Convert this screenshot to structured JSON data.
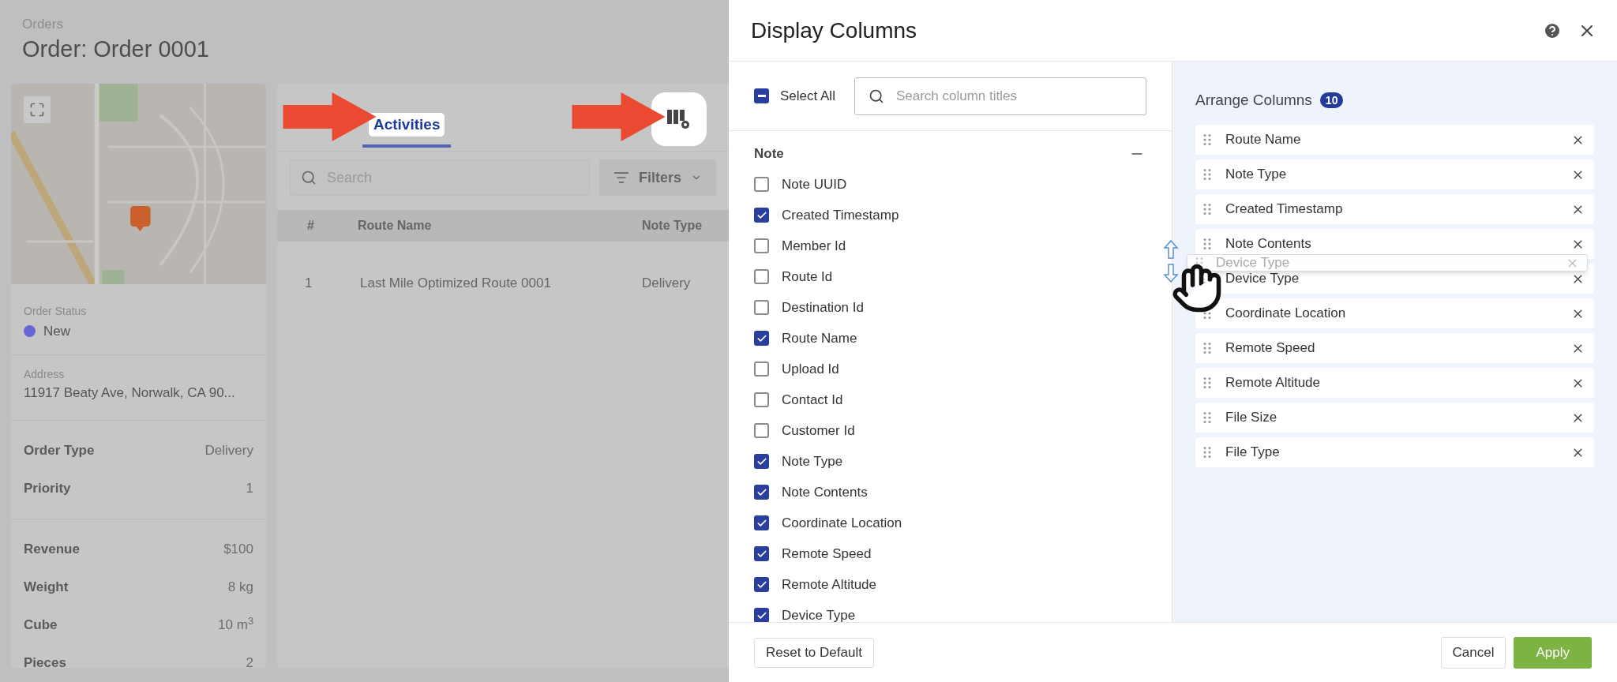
{
  "background_page": {
    "breadcrumb": "Orders",
    "title": "Order: Order 0001",
    "order_card": {
      "status_label": "Order Status",
      "status": {
        "text": "New",
        "color": "#6666d6"
      },
      "address_label": "Address",
      "address": "11917 Beaty Ave, Norwalk, CA 90...",
      "detail_groups": [
        [
          {
            "label": "Order Type",
            "value": "Delivery"
          },
          {
            "label": "Priority",
            "value": "1"
          }
        ],
        [
          {
            "label": "Revenue",
            "value": "$100"
          },
          {
            "label": "Weight",
            "value": "8 kg"
          },
          {
            "label": "Cube",
            "value": "10 m$^{3}$"
          },
          {
            "label": "Pieces",
            "value": "2"
          }
        ]
      ]
    },
    "tabs": [
      {
        "label": "Activities",
        "selected": true
      }
    ],
    "search": {
      "placeholder": "Search"
    },
    "filters_button": "Filters",
    "table": {
      "columns": [
        "#",
        "Route Name",
        "Note Type"
      ],
      "rows": [
        [
          "1",
          "Last Mile Optimized Route 0001",
          "Delivery"
        ]
      ]
    }
  },
  "dialog": {
    "title": "Display Columns",
    "select_all": {
      "label": "Select All",
      "indeterminate": true
    },
    "search": {
      "placeholder": "Search column titles"
    },
    "group": {
      "title": "Note",
      "expanded": true,
      "items": [
        {
          "label": "Note UUID",
          "checked": false
        },
        {
          "label": "Created Timestamp",
          "checked": true
        },
        {
          "label": "Member Id",
          "checked": false
        },
        {
          "label": "Route Id",
          "checked": false
        },
        {
          "label": "Destination Id",
          "checked": false
        },
        {
          "label": "Route Name",
          "checked": true
        },
        {
          "label": "Upload Id",
          "checked": false
        },
        {
          "label": "Contact Id",
          "checked": false
        },
        {
          "label": "Customer Id",
          "checked": false
        },
        {
          "label": "Note Type",
          "checked": true
        },
        {
          "label": "Note Contents",
          "checked": true
        },
        {
          "label": "Coordinate Location",
          "checked": true
        },
        {
          "label": "Remote Speed",
          "checked": true
        },
        {
          "label": "Remote Altitude",
          "checked": true
        },
        {
          "label": "Device Type",
          "checked": true
        }
      ]
    },
    "arrange": {
      "title": "Arrange Columns",
      "count": "10",
      "items": [
        "Route Name",
        "Note Type",
        "Created Timestamp",
        "Note Contents",
        "Device Type",
        "Coordinate Location",
        "Remote Speed",
        "Remote Altitude",
        "File Size",
        "File Type"
      ]
    },
    "drag_ghost": {
      "label": "Device Type"
    },
    "buttons": {
      "reset": "Reset to Default",
      "cancel": "Cancel",
      "apply": "Apply"
    }
  }
}
